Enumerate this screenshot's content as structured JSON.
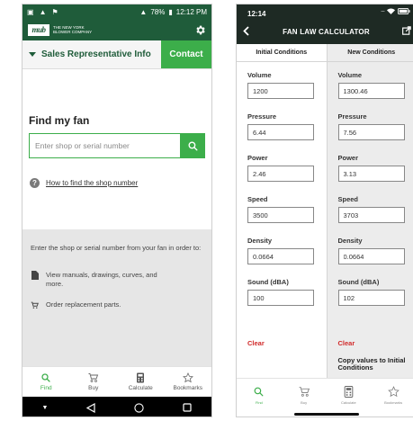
{
  "left": {
    "status": {
      "time": "12:12 PM",
      "battery": "78%"
    },
    "app": {
      "logo": "mub",
      "company_line1": "THE NEW YORK",
      "company_line2": "BLOWER COMPANY"
    },
    "info_bar": {
      "label": "Sales Representative Info",
      "contact": "Contact"
    },
    "find_title": "Find my fan",
    "search": {
      "placeholder": "Enter shop or serial number"
    },
    "help_link": "How to find the shop number",
    "panel": {
      "intro": "Enter the shop or serial number from your fan in order to:",
      "items": [
        {
          "icon": "document-icon",
          "text": "View manuals, drawings, curves, and more."
        },
        {
          "icon": "cart-icon",
          "text": "Order replacement parts."
        }
      ]
    },
    "tabs": [
      {
        "label": "Find",
        "icon": "search-icon",
        "active": true
      },
      {
        "label": "Buy",
        "icon": "cart-icon",
        "active": false
      },
      {
        "label": "Calculate",
        "icon": "calculator-icon",
        "active": false
      },
      {
        "label": "Bookmarks",
        "icon": "star-icon",
        "active": false
      }
    ]
  },
  "right": {
    "status": {
      "time": "12:14"
    },
    "title": "FAN LAW CALCULATOR",
    "col_initial": "Initial Conditions",
    "col_new": "New Conditions",
    "fields": [
      {
        "label": "Volume",
        "initial": "1200",
        "new": "1300.46"
      },
      {
        "label": "Pressure",
        "initial": "6.44",
        "new": "7.56"
      },
      {
        "label": "Power",
        "initial": "2.46",
        "new": "3.13"
      },
      {
        "label": "Speed",
        "initial": "3500",
        "new": "3703"
      },
      {
        "label": "Density",
        "initial": "0.0664",
        "new": "0.0664"
      },
      {
        "label": "Sound (dBA)",
        "initial": "100",
        "new": "102"
      }
    ],
    "clear": "Clear",
    "copy": "Copy values to Initial Conditions",
    "tabs": [
      {
        "label": "Find",
        "icon": "search-icon",
        "active": true
      },
      {
        "label": "Buy",
        "icon": "cart-icon",
        "active": false
      },
      {
        "label": "Calculate",
        "icon": "calculator-icon",
        "active": false
      },
      {
        "label": "Bookmarks",
        "icon": "star-icon",
        "active": false
      }
    ]
  },
  "colors": {
    "brand_green": "#1f5c3a",
    "accent_green": "#3cae4a",
    "clear_red": "#d12a2a",
    "right_header": "#1e2a24"
  }
}
